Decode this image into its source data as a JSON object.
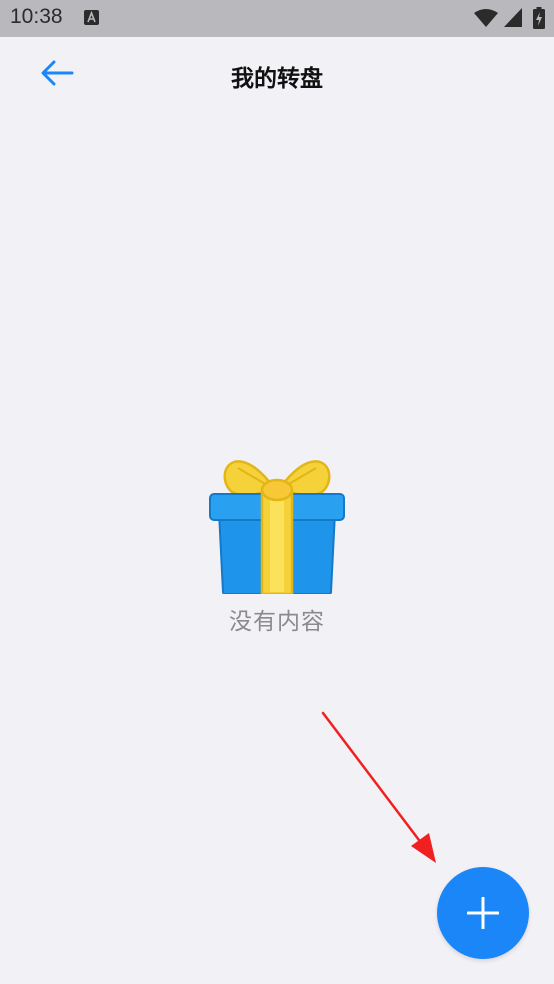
{
  "status_bar": {
    "time": "10:38",
    "icons": [
      "a-notification-icon",
      "wifi-icon",
      "signal-icon",
      "battery-charging-icon"
    ]
  },
  "app_bar": {
    "back_icon": "arrow-left-icon",
    "title": "我的转盘"
  },
  "empty_state": {
    "icon": "gift-icon",
    "message": "没有内容"
  },
  "fab": {
    "icon": "plus-icon"
  },
  "colors": {
    "accent": "#1a86f8",
    "background": "#f2f1f6",
    "status_bar": "#b9b8bd",
    "annotation_arrow": "#f02020"
  }
}
